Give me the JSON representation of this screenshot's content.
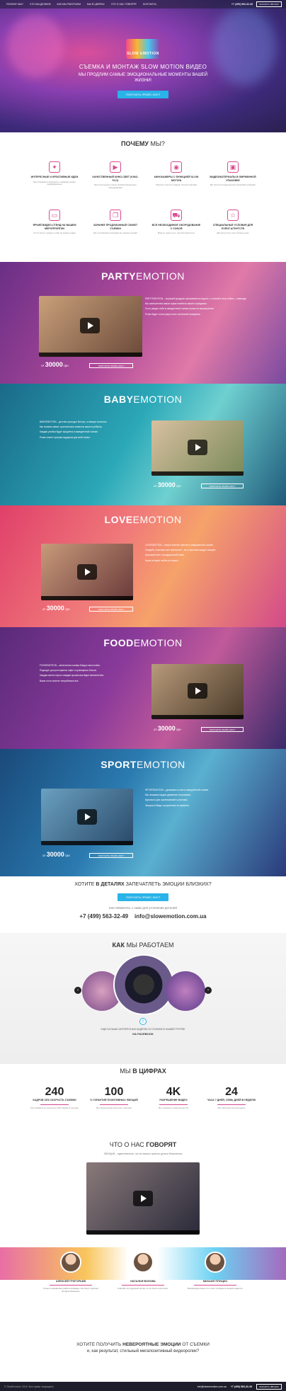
{
  "nav": {
    "items": [
      "ПОЧЕМУ МЫ?",
      "ЧТО МЫ ДЕЛАЕМ",
      "КАК МЫ РАБОТАЕМ",
      "МЫ В ЦИФРАХ",
      "ЧТО О НАС ГОВОРЯТ",
      "КОНТАКТЫ"
    ],
    "phone": "+7 (499) 563-32-49",
    "call_label": "ЗАКАЗАТЬ ЗВОНОК"
  },
  "hero": {
    "logo": "SLOW EMOTION",
    "title": "СЪЕМКА И МОНТАЖ SLOW MOTION ВИДЕО",
    "subtitle": "МЫ ПРОДЛИМ САМЫЕ ЭМОЦИОНАЛЬНЫЕ МОМЕНТЫ ВАШЕЙ ЖИЗНИ!",
    "button": "ПОЛУЧИТЬ ПРАЙС-ЛИСТ"
  },
  "why": {
    "title_a": "ПОЧЕМУ",
    "title_b": "МЫ?",
    "features": [
      {
        "icon": "bulb-icon",
        "glyph": "✦",
        "title": "ИНТЕРЕСНЫЕ И КРЕАТИВНЫЕ ИДЕИ",
        "desc": "Мы стараемся подходить к каждому видео индивидуально"
      },
      {
        "icon": "video-icon",
        "glyph": "▶",
        "title": "КАЧЕСТВЕННЫЙ КИНО-СВЕТ (KINO-FLO)",
        "desc": "Мы используем только профессиональное оборудование"
      },
      {
        "icon": "camera-icon",
        "glyph": "◉",
        "title": "КИНОКАМЕРЫ С ФУНКЦИЕЙ SLOW MOTION",
        "desc": "Меньше частоты кадров, больше эмоций"
      },
      {
        "icon": "gift-icon",
        "glyph": "▣",
        "title": "ВИДЕОМАТЕРИАЛЫ В ФИРМЕННОЙ УПАКОВКЕ",
        "desc": "Вы получите видеоролик в красивой упаковке"
      },
      {
        "icon": "monitor-icon",
        "glyph": "▭",
        "title": "ЯРКИЙ ВИДЕО-СТЕНД НА ВАШЕМ МЕРОПРИЯТИИ",
        "desc": "Гости смогут увидеть себя на экране сразу"
      },
      {
        "icon": "book-icon",
        "glyph": "❒",
        "title": "ЗАРАНЕЕ ПРОДУМАННЫЙ СЮЖЕТ СЪЕМКИ",
        "desc": "Мы составляем сценарий до начала съемки"
      },
      {
        "icon": "truck-icon",
        "glyph": "⛟",
        "title": "ВСЕ НЕОБХОДИМОЕ ОБОРУДОВАНИЕ С СОБОЙ",
        "desc": "Вам не нужно ни о чем беспокоиться"
      },
      {
        "icon": "star-icon",
        "glyph": "☆",
        "title": "СПЕЦИАЛЬНЫЕ УСЛОВИЯ ДЛЯ EVENT-АГЕНТСТВ",
        "desc": "Для агентств у нас особые цены"
      }
    ]
  },
  "emotions": [
    {
      "id": "party",
      "title_a": "PARTY",
      "title_b": "EMOTION",
      "price_prefix": "от",
      "price": "30000",
      "currency": "грн",
      "button": "ПОЛУЧИТЬ ПРАЙС-ЛИСТ",
      "text": [
        "PARTYEMOTION – хороший праздник запоминается надолго, а снятый в slow motion – навсегда.",
        "Мы запечатлеем самые яркие моменты вашего праздника.",
        "Гости увидят себя в замедленной съемке прямо на мероприятии.",
        "Ролик будет готов сразу после окончания праздника."
      ]
    },
    {
      "id": "baby",
      "title_a": "BABY",
      "title_b": "EMOTION",
      "price_prefix": "от",
      "price": "30000",
      "currency": "грн",
      "button": "ПОЛУЧИТЬ ПРАЙС-ЛИСТ",
      "text": [
        "BABYEMOTION – детство проходит быстро, а эмоции остаются.",
        "Мы снимем самые трогательные моменты вашего ребенка.",
        "Каждая улыбка будет продлена в замедленной съемке.",
        "Ролик станет лучшим подарком для всей семьи."
      ]
    },
    {
      "id": "love",
      "title_a": "LOVE",
      "title_b": "EMOTION",
      "price_prefix": "от",
      "price": "30000",
      "currency": "грн",
      "button": "ПОЛУЧИТЬ ПРАЙС-ЛИСТ",
      "text": [
        "LOVEEMOTION – самые нежные чувства в замедленной съемке.",
        "Свадьба, помолвка или признание – мы сохраним каждую эмоцию.",
        "Красивый свет и продуманный сюжет.",
        "Ваша история любви на экране."
      ]
    },
    {
      "id": "food",
      "title_a": "FOOD",
      "title_b": "EMOTION",
      "price_prefix": "от",
      "price": "30000",
      "currency": "грн",
      "button": "ПОЛУЧИТЬ ПРАЙС-ЛИСТ",
      "text": [
        "FOODEMOTION – аппетитная съемка блюд в slow motion.",
        "Подходит для ресторанов, кафе и кулинарных блогов.",
        "Каждая капля соуса и каждая крошка выглядят великолепно.",
        "Ваши гости захотят попробовать все."
      ]
    },
    {
      "id": "sport",
      "title_a": "SPORT",
      "title_b": "EMOTION",
      "price_prefix": "от",
      "price": "30000",
      "currency": "грн",
      "button": "ПОЛУЧИТЬ ПРАЙС-ЛИСТ",
      "text": [
        "SPORTEMOTION – динамика и сила в замедленной съемке.",
        "Мы покажем каждое движение спортсмена.",
        "Идеально для соревнований и рекламы.",
        "Эмоции победы, продленные во времени."
      ]
    }
  ],
  "cta": {
    "question_a": "ХОТИТЕ",
    "question_b": "В ДЕТАЛЯХ",
    "question_c": "ЗАПЕЧАТЛЕТЬ ЭМОЦИИ БЛИЗКИХ?",
    "button": "ПОЛУЧИТЬ ПРАЙС-ЛИСТ",
    "or_text": "или свяжитесь с нами для уточнения деталей",
    "phone": "+7 (499) 563-32-49",
    "email": "info@slowemotion.com.ua"
  },
  "how": {
    "title_a": "КАК",
    "title_b": "МЫ РАБОТАЕМ",
    "facebook_text": "ЕЩЕ БОЛЬШЕ ИНТЕРЕСНЫХ КАДРОВ СО СЪЕМОК В НАШЕЙ ГРУППЕ",
    "facebook_link": "НА FACEBOOK"
  },
  "numbers": {
    "title_a": "МЫ",
    "title_b": "В ЦИФРАХ",
    "items": [
      {
        "value": "240",
        "label": "КАДРОВ СЕК СКОРОСТЬ СЪЕМКИ",
        "desc": "Мы снимаем со скоростью 240 кадров в секунду"
      },
      {
        "value": "100",
        "label": "% ГАРАНТИЯ ПОЗИТИВНЫХ ЭМОЦИЙ",
        "desc": "Мы гарантируем качество и эмоции"
      },
      {
        "value": "4K",
        "label": "РАЗРЕШЕНИЕ ВИДЕО",
        "desc": "Мы снимаем в разрешении 4K"
      },
      {
        "value": "24",
        "label": "ЧАСА 7 ДНЕЙ, СЕМЬ ДНЕЙ В НЕДЕЛЮ",
        "desc": "Мы работаем без выходных"
      }
    ]
  },
  "reviews": {
    "title_a": "ЧТО О НАС",
    "title_b": "ГОВОРЯТ",
    "intro": "ЭМОЦИИ – единственное, на что можно тратить деньги бесконечно",
    "people": [
      {
        "name": "АЛЕКСЕЙ ГРИГОРЬЕВ",
        "text": "Очень понравилась работа команды, все было сделано профессионально."
      },
      {
        "name": "НАТАЛЬЯ ВОЛОВА",
        "text": "Спасибо за чудесный ролик, гости были в восторге."
      },
      {
        "name": "МИХАИЛ ПЛУЩКО",
        "text": "Рекомендую всем, кто хочет сохранить эмоции надолго."
      }
    ]
  },
  "final": {
    "q_a": "ХОТИТЕ ПОЛУЧИТЬ",
    "q_b": "НЕВЕРОЯТНЫЕ ЭМОЦИИ",
    "q_c": "ОТ СЪЕМКИ",
    "q_d": "и, как результат, стильный мегапозитивный видеоролик?"
  },
  "footer": {
    "copyright": "© SlowEmotion 2016. Все права защищены",
    "email": "info@slowemotion.com.ua",
    "phone": "+7 (499) 563-32-49",
    "call_label": "ЗАКАЗАТЬ ЗВОНОК"
  },
  "colors": {
    "accent": "#d74a8f",
    "button": "#29b3e8"
  }
}
